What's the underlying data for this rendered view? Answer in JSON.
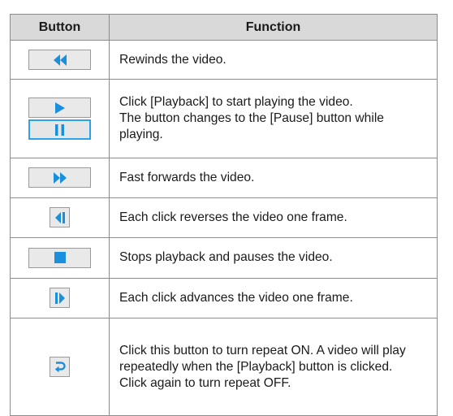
{
  "header": {
    "button": "Button",
    "function": "Function"
  },
  "accent": "#1a8fdc",
  "rows": [
    {
      "icons": [
        "rewind-icon"
      ],
      "lines": [
        "Rewinds the video."
      ]
    },
    {
      "icons": [
        "play-icon",
        "pause-icon"
      ],
      "lines": [
        "Click [Playback] to start playing the video.",
        "The button changes to the [Pause] button while playing."
      ]
    },
    {
      "icons": [
        "fast-forward-icon"
      ],
      "lines": [
        "Fast forwards the video."
      ]
    },
    {
      "icons": [
        "step-back-icon"
      ],
      "lines": [
        "Each click reverses the video one frame."
      ]
    },
    {
      "icons": [
        "stop-icon"
      ],
      "lines": [
        "Stops playback and pauses the video."
      ]
    },
    {
      "icons": [
        "step-forward-icon"
      ],
      "lines": [
        "Each click advances the video one frame."
      ]
    },
    {
      "icons": [
        "repeat-icon"
      ],
      "lines": [
        "Click this button to turn repeat ON. A video will play repeatedly when the [Playback] button is clicked.",
        "Click again to turn repeat OFF."
      ]
    }
  ]
}
